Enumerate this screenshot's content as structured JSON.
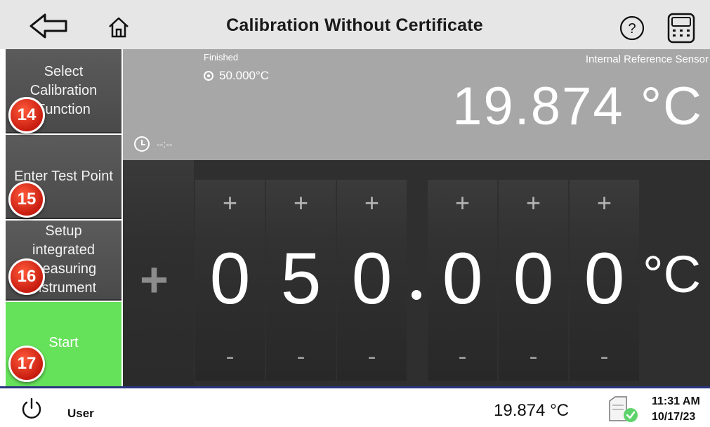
{
  "header": {
    "title": "Calibration Without Certificate",
    "back_icon": "back-arrow-icon",
    "home_icon": "home-icon",
    "help_icon": "help-icon",
    "calculator_icon": "calculator-icon"
  },
  "sidebar": {
    "items": [
      {
        "label": "Select Calibration Function",
        "badge": "14"
      },
      {
        "label": "Enter Test Point",
        "badge": "15"
      },
      {
        "label": "Setup integrated measuring instrument",
        "badge": "16"
      },
      {
        "label": "Start",
        "badge": "17"
      }
    ],
    "start_color": "#66e15a",
    "badge_color": "#d9261a"
  },
  "info": {
    "status": "Finished",
    "target": "50.000°C",
    "sensor_label": "Internal Reference Sensor",
    "reading": "19.874 °C",
    "timer": "--:--"
  },
  "entry": {
    "sign": "+",
    "plus": "+",
    "minus": "-",
    "digits": [
      "0",
      "5",
      "0",
      "0",
      "0",
      "0"
    ],
    "unit": "°C"
  },
  "statusbar": {
    "user": "User",
    "temperature": "19.874 °C",
    "time": "11:31 AM",
    "date": "10/17/23",
    "power_icon": "power-icon",
    "device_icon": "device-connected-icon",
    "accent": "#2a3580"
  }
}
